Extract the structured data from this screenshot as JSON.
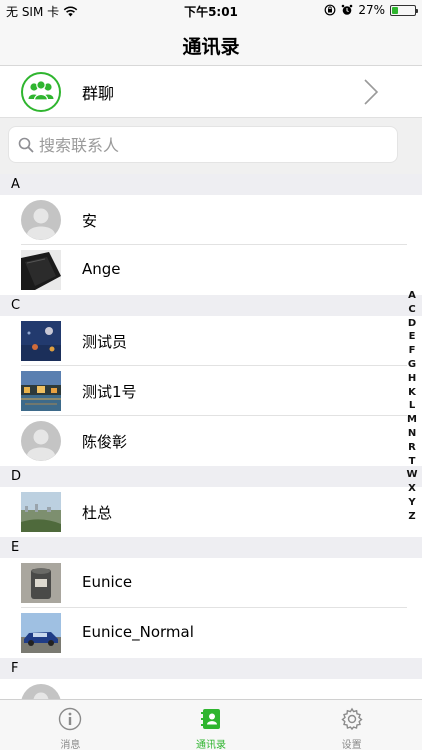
{
  "status_bar": {
    "carrier": "无 SIM 卡",
    "time": "下午5:01",
    "battery_percent": "27%",
    "battery_level": 0.27
  },
  "nav": {
    "title": "通讯录"
  },
  "group_chat": {
    "label": "群聊"
  },
  "search": {
    "placeholder": "搜索联系人"
  },
  "sections": [
    {
      "letter": "A",
      "contacts": [
        {
          "name": "安",
          "avatar": "default-avatar"
        },
        {
          "name": "Ange",
          "avatar": "phone-photo"
        }
      ]
    },
    {
      "letter": "C",
      "contacts": [
        {
          "name": "测试员",
          "avatar": "blue-table-photo"
        },
        {
          "name": "测试1号",
          "avatar": "canal-night-photo"
        },
        {
          "name": "陈俊彰",
          "avatar": "default-avatar"
        }
      ]
    },
    {
      "letter": "D",
      "contacts": [
        {
          "name": "杜总",
          "avatar": "city-view-photo"
        }
      ]
    },
    {
      "letter": "E",
      "contacts": [
        {
          "name": "Eunice",
          "avatar": "cup-photo"
        },
        {
          "name": "Eunice_Normal",
          "avatar": "car-photo"
        }
      ]
    },
    {
      "letter": "F",
      "contacts": [
        {
          "name": "",
          "avatar": "default-avatar"
        }
      ]
    }
  ],
  "index_letters": [
    "A",
    "C",
    "D",
    "E",
    "F",
    "G",
    "H",
    "K",
    "L",
    "M",
    "N",
    "R",
    "T",
    "W",
    "X",
    "Y",
    "Z"
  ],
  "tabs": [
    {
      "label": "消息",
      "icon": "info-icon",
      "active": false
    },
    {
      "label": "通讯录",
      "icon": "contacts-book-icon",
      "active": true
    },
    {
      "label": "设置",
      "icon": "gear-icon",
      "active": false
    }
  ],
  "colors": {
    "accent": "#2fb52f",
    "section_bg": "#eeeef2",
    "bar_bg": "#f7f7f7"
  }
}
